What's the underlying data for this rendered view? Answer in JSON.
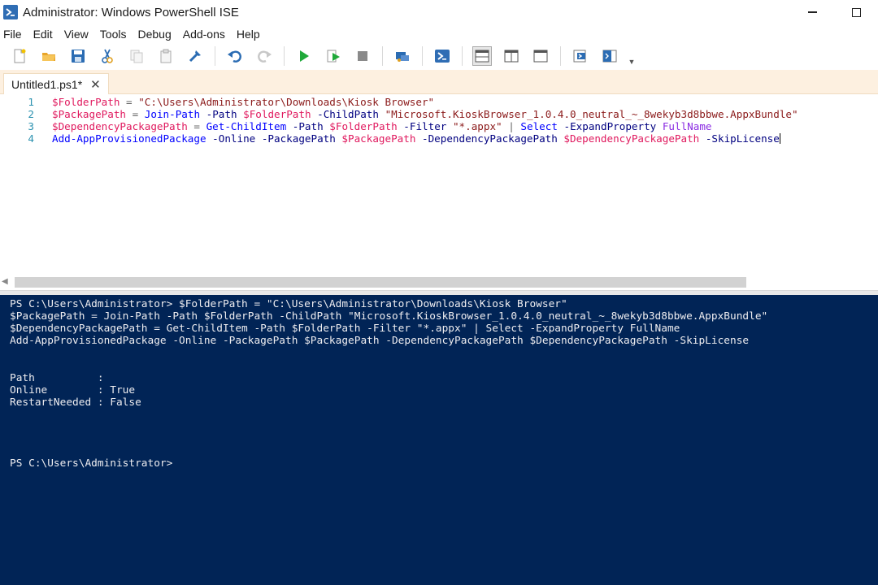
{
  "window": {
    "title": "Administrator: Windows PowerShell ISE",
    "app_icon": "powershell-ise-icon"
  },
  "menu": [
    "File",
    "Edit",
    "View",
    "Tools",
    "Debug",
    "Add-ons",
    "Help"
  ],
  "toolbar": {
    "icons": [
      "new-script-icon",
      "open-icon",
      "save-icon",
      "cut-icon",
      "copy-icon",
      "paste-icon",
      "clear-console-icon",
      "undo-icon",
      "redo-icon",
      "run-script-icon",
      "run-selection-icon",
      "stop-icon",
      "remote-powershell-icon",
      "powershell-console-icon",
      "show-script-top-icon",
      "show-script-right-icon",
      "show-script-maximized-icon",
      "show-commands-icon",
      "show-command-addon-icon"
    ]
  },
  "tab": {
    "label": "Untitled1.ps1*",
    "close_glyph": "✕"
  },
  "editor": {
    "lines": [
      {
        "number": "1",
        "tokens": [
          {
            "t": "var",
            "v": "$FolderPath"
          },
          {
            "t": "plain",
            "v": " "
          },
          {
            "t": "op",
            "v": "="
          },
          {
            "t": "plain",
            "v": " "
          },
          {
            "t": "str",
            "v": "\"C:\\Users\\Administrator\\Downloads\\Kiosk Browser\""
          }
        ]
      },
      {
        "number": "2",
        "tokens": [
          {
            "t": "var",
            "v": "$PackagePath"
          },
          {
            "t": "plain",
            "v": " "
          },
          {
            "t": "op",
            "v": "="
          },
          {
            "t": "plain",
            "v": " "
          },
          {
            "t": "cmd",
            "v": "Join-Path"
          },
          {
            "t": "plain",
            "v": " "
          },
          {
            "t": "param",
            "v": "-Path"
          },
          {
            "t": "plain",
            "v": " "
          },
          {
            "t": "var",
            "v": "$FolderPath"
          },
          {
            "t": "plain",
            "v": " "
          },
          {
            "t": "param",
            "v": "-ChildPath"
          },
          {
            "t": "plain",
            "v": " "
          },
          {
            "t": "str",
            "v": "\"Microsoft.KioskBrowser_1.0.4.0_neutral_~_8wekyb3d8bbwe.AppxBundle\""
          }
        ]
      },
      {
        "number": "3",
        "tokens": [
          {
            "t": "var",
            "v": "$DependencyPackagePath"
          },
          {
            "t": "plain",
            "v": " "
          },
          {
            "t": "op",
            "v": "="
          },
          {
            "t": "plain",
            "v": " "
          },
          {
            "t": "cmd",
            "v": "Get-ChildItem"
          },
          {
            "t": "plain",
            "v": " "
          },
          {
            "t": "param",
            "v": "-Path"
          },
          {
            "t": "plain",
            "v": " "
          },
          {
            "t": "var",
            "v": "$FolderPath"
          },
          {
            "t": "plain",
            "v": " "
          },
          {
            "t": "param",
            "v": "-Filter"
          },
          {
            "t": "plain",
            "v": " "
          },
          {
            "t": "str",
            "v": "\"*.appx\""
          },
          {
            "t": "plain",
            "v": " "
          },
          {
            "t": "op",
            "v": "|"
          },
          {
            "t": "plain",
            "v": " "
          },
          {
            "t": "cmd",
            "v": "Select"
          },
          {
            "t": "plain",
            "v": " "
          },
          {
            "t": "param",
            "v": "-ExpandProperty"
          },
          {
            "t": "plain",
            "v": " "
          },
          {
            "t": "gray",
            "v": "FullName"
          }
        ]
      },
      {
        "number": "4",
        "tokens": [
          {
            "t": "cmd",
            "v": "Add-AppProvisionedPackage"
          },
          {
            "t": "plain",
            "v": " "
          },
          {
            "t": "param",
            "v": "-Online"
          },
          {
            "t": "plain",
            "v": " "
          },
          {
            "t": "param",
            "v": "-PackagePath"
          },
          {
            "t": "plain",
            "v": " "
          },
          {
            "t": "var",
            "v": "$PackagePath"
          },
          {
            "t": "plain",
            "v": " "
          },
          {
            "t": "param",
            "v": "-DependencyPackagePath"
          },
          {
            "t": "plain",
            "v": " "
          },
          {
            "t": "var",
            "v": "$DependencyPackagePath"
          },
          {
            "t": "plain",
            "v": " "
          },
          {
            "t": "param",
            "v": "-SkipLicense"
          }
        ],
        "caret": true
      }
    ]
  },
  "console": {
    "lines": [
      "PS C:\\Users\\Administrator> $FolderPath = \"C:\\Users\\Administrator\\Downloads\\Kiosk Browser\"",
      "$PackagePath = Join-Path -Path $FolderPath -ChildPath \"Microsoft.KioskBrowser_1.0.4.0_neutral_~_8wekyb3d8bbwe.AppxBundle\"",
      "$DependencyPackagePath = Get-ChildItem -Path $FolderPath -Filter \"*.appx\" | Select -ExpandProperty FullName",
      "Add-AppProvisionedPackage -Online -PackagePath $PackagePath -DependencyPackagePath $DependencyPackagePath -SkipLicense",
      "",
      "",
      "Path          :",
      "Online        : True",
      "RestartNeeded : False",
      "",
      "",
      "",
      "",
      "PS C:\\Users\\Administrator>"
    ]
  },
  "colors": {
    "console_background": "#012456",
    "console_text": "#eeedf0",
    "tabstrip_background": "#fdf0e0",
    "line_number": "#2b91af"
  }
}
